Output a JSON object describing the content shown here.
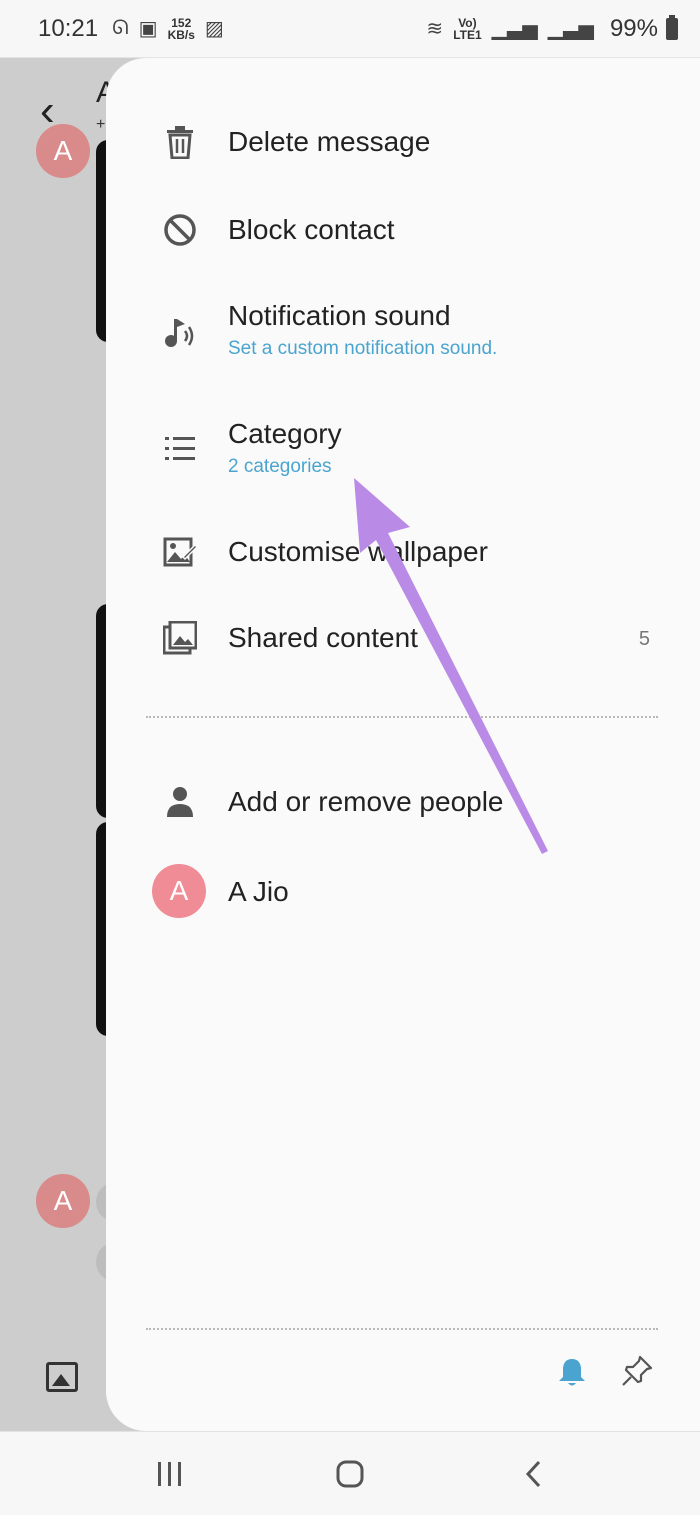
{
  "status_bar": {
    "time": "10:21",
    "net_speed_value": "152",
    "net_speed_unit": "KB/s",
    "volte_label": "Vo)",
    "lte_label": "LTE1",
    "battery": "99%"
  },
  "background_app": {
    "title_initial": "A",
    "subtitle_initial": "+",
    "avatar_letter": "A"
  },
  "drawer": {
    "menu": [
      {
        "label": "Delete message",
        "icon": "trash-icon"
      },
      {
        "label": "Block contact",
        "icon": "block-icon"
      },
      {
        "label": "Notification sound",
        "sub": "Set a custom notification sound.",
        "icon": "music-note-icon"
      },
      {
        "label": "Category",
        "sub": "2 categories",
        "icon": "list-icon"
      },
      {
        "label": "Customise wallpaper",
        "icon": "wallpaper-edit-icon"
      },
      {
        "label": "Shared content",
        "count": "5",
        "icon": "gallery-icon"
      }
    ],
    "people": {
      "add_label": "Add or remove people",
      "contact_name": "A Jio",
      "contact_initial": "A"
    }
  },
  "colors": {
    "accent_blue": "#4aa4cf",
    "avatar_pink": "#f08c95",
    "annotation_purple": "#b98ae6"
  }
}
